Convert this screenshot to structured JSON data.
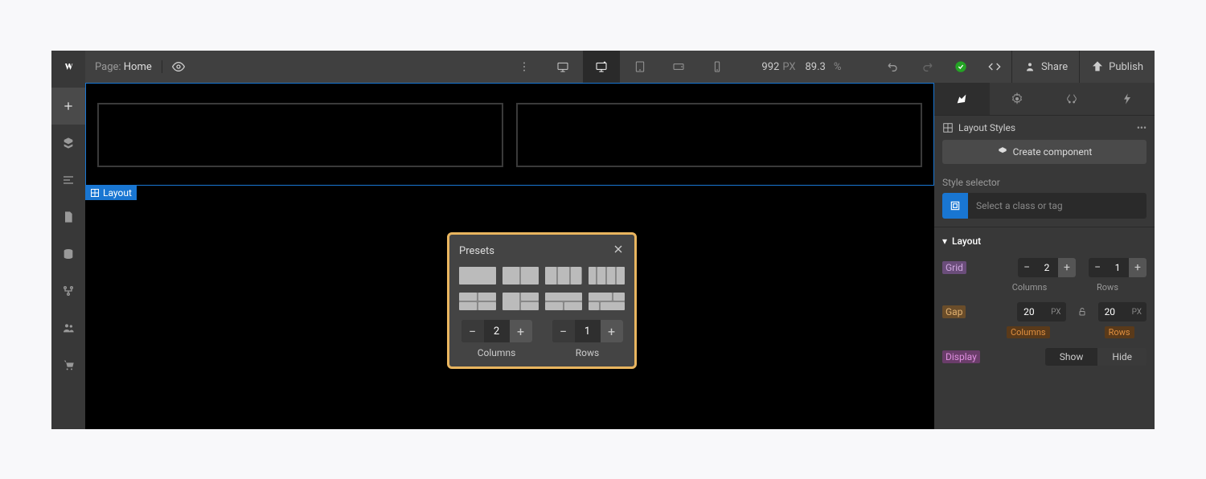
{
  "topbar": {
    "page_prefix": "Page:",
    "page_name": "Home",
    "width_value": "992",
    "width_unit": "PX",
    "zoom_value": "89.3",
    "zoom_unit": "%",
    "share_label": "Share",
    "publish_label": "Publish"
  },
  "canvas": {
    "selection_label": "Layout"
  },
  "presets": {
    "title": "Presets",
    "columns_value": "2",
    "columns_label": "Columns",
    "rows_value": "1",
    "rows_label": "Rows"
  },
  "rightpanel": {
    "layout_styles_label": "Layout Styles",
    "create_component_label": "Create component",
    "style_selector_label": "Style selector",
    "class_placeholder": "Select a class or tag",
    "layout_section": "Layout",
    "grid_label": "Grid",
    "grid_cols": "2",
    "grid_rows": "1",
    "cols_label": "Columns",
    "rows_label": "Rows",
    "gap_label": "Gap",
    "gap_cols": "20",
    "gap_rows": "20",
    "gap_unit": "PX",
    "gap_cols_label": "Columns",
    "gap_rows_label": "Rows",
    "display_label": "Display",
    "show_label": "Show",
    "hide_label": "Hide"
  }
}
